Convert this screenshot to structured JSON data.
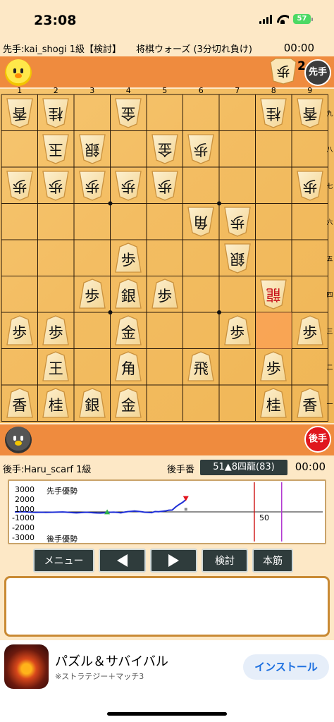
{
  "status": {
    "time": "23:08",
    "battery": "57"
  },
  "game": {
    "sente_player": "先手:kai_shogi 1級【検討】",
    "rule": "将棋ウォーズ (3分切れ負け)",
    "sente_clock": "00:00",
    "gote_player": "後手:Haru_scarf 1級",
    "turn_label": "後手番",
    "last_move": "51▲8四龍(83)",
    "gote_clock": "00:00"
  },
  "hands": {
    "sente_piece": "歩",
    "sente_count": "2",
    "sente_badge": "先手",
    "gote_badge": "後手"
  },
  "board": {
    "file_labels": [
      "1",
      "2",
      "3",
      "4",
      "5",
      "6",
      "7",
      "8",
      "9"
    ],
    "rank_labels": [
      "九",
      "八",
      "七",
      "六",
      "五",
      "四",
      "三",
      "二",
      "一"
    ],
    "pieces": [
      {
        "c": 0,
        "r": 0,
        "k": "香",
        "o": "gote"
      },
      {
        "c": 1,
        "r": 0,
        "k": "桂",
        "o": "gote"
      },
      {
        "c": 3,
        "r": 0,
        "k": "金",
        "o": "gote"
      },
      {
        "c": 7,
        "r": 0,
        "k": "桂",
        "o": "gote"
      },
      {
        "c": 8,
        "r": 0,
        "k": "香",
        "o": "gote"
      },
      {
        "c": 1,
        "r": 1,
        "k": "玉",
        "o": "gote"
      },
      {
        "c": 2,
        "r": 1,
        "k": "銀",
        "o": "gote"
      },
      {
        "c": 4,
        "r": 1,
        "k": "金",
        "o": "gote"
      },
      {
        "c": 5,
        "r": 1,
        "k": "歩",
        "o": "gote"
      },
      {
        "c": 0,
        "r": 2,
        "k": "歩",
        "o": "gote"
      },
      {
        "c": 1,
        "r": 2,
        "k": "歩",
        "o": "gote"
      },
      {
        "c": 2,
        "r": 2,
        "k": "歩",
        "o": "gote"
      },
      {
        "c": 3,
        "r": 2,
        "k": "歩",
        "o": "gote"
      },
      {
        "c": 4,
        "r": 2,
        "k": "歩",
        "o": "gote"
      },
      {
        "c": 8,
        "r": 2,
        "k": "歩",
        "o": "gote"
      },
      {
        "c": 5,
        "r": 3,
        "k": "角",
        "o": "gote"
      },
      {
        "c": 6,
        "r": 3,
        "k": "歩",
        "o": "gote"
      },
      {
        "c": 6,
        "r": 4,
        "k": "銀",
        "o": "gote"
      },
      {
        "c": 3,
        "r": 4,
        "k": "歩",
        "o": "sente"
      },
      {
        "c": 2,
        "r": 5,
        "k": "歩",
        "o": "sente"
      },
      {
        "c": 3,
        "r": 5,
        "k": "銀",
        "o": "sente"
      },
      {
        "c": 4,
        "r": 5,
        "k": "歩",
        "o": "sente"
      },
      {
        "c": 7,
        "r": 5,
        "k": "龍",
        "o": "gote",
        "p": true
      },
      {
        "c": 0,
        "r": 6,
        "k": "歩",
        "o": "sente"
      },
      {
        "c": 1,
        "r": 6,
        "k": "歩",
        "o": "sente"
      },
      {
        "c": 3,
        "r": 6,
        "k": "金",
        "o": "sente"
      },
      {
        "c": 6,
        "r": 6,
        "k": "歩",
        "o": "sente"
      },
      {
        "c": 8,
        "r": 6,
        "k": "歩",
        "o": "sente"
      },
      {
        "c": 1,
        "r": 7,
        "k": "王",
        "o": "sente"
      },
      {
        "c": 3,
        "r": 7,
        "k": "角",
        "o": "sente"
      },
      {
        "c": 5,
        "r": 7,
        "k": "飛",
        "o": "sente"
      },
      {
        "c": 7,
        "r": 7,
        "k": "歩",
        "o": "sente"
      },
      {
        "c": 0,
        "r": 8,
        "k": "香",
        "o": "sente"
      },
      {
        "c": 1,
        "r": 8,
        "k": "桂",
        "o": "sente"
      },
      {
        "c": 2,
        "r": 8,
        "k": "銀",
        "o": "sente"
      },
      {
        "c": 3,
        "r": 8,
        "k": "金",
        "o": "sente"
      },
      {
        "c": 7,
        "r": 8,
        "k": "桂",
        "o": "sente"
      },
      {
        "c": 8,
        "r": 8,
        "k": "香",
        "o": "sente"
      }
    ],
    "last_move_square": {
      "c": 7,
      "r": 6
    }
  },
  "graph": {
    "y_labels": [
      "3000",
      "2000",
      "1000",
      "-1000",
      "-2000",
      "-3000"
    ],
    "sente_adv": "先手優勢",
    "gote_adv": "後手優勢",
    "x_mark": "50",
    "values": [
      0,
      0,
      20,
      10,
      -20,
      -40,
      -60,
      -50,
      -40,
      -60,
      -50,
      -40,
      -30,
      -20,
      -10,
      -30,
      -60,
      -80,
      -100,
      -80,
      -60,
      -40,
      -70,
      -90,
      -110,
      -120,
      -100,
      -60,
      -40,
      -30,
      -60,
      -100,
      -30,
      30,
      60,
      90,
      60,
      20,
      -40,
      -60,
      -80,
      40,
      20,
      60,
      100,
      180,
      200,
      520,
      780,
      1000,
      1300
    ],
    "current_move": 51,
    "line_color": "#1f2fd6",
    "current_line_color": "#d01515",
    "view_line_color": "#b23ad1"
  },
  "controls": {
    "menu": "メニュー",
    "analyze": "検討",
    "source": "本筋"
  },
  "ad": {
    "title": "パズル＆サバイバル",
    "subtitle": "※ストラテジー＋マッチ3",
    "install": "インストール"
  }
}
